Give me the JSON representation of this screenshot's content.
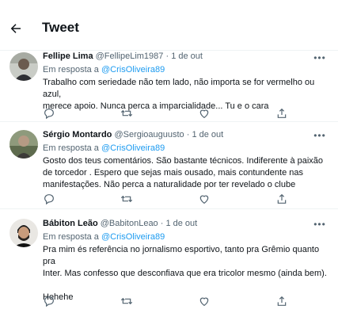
{
  "header": {
    "title": "Tweet"
  },
  "tweets": [
    {
      "name": "Fellipe Lima",
      "handle": "@FellipeLim1987",
      "time": "· 1 de out",
      "reply_prefix": "Em resposta a ",
      "reply_to": "@CrisOliveira89",
      "lines": [
        "Trabalho com seriedade não tem lado, não importa se for vermelho ou azul,",
        "merece apoio. Nunca perca a imparcialidade... Tu e o cara"
      ]
    },
    {
      "name": "Sérgio Montardo",
      "handle": "@Sergioauguusto",
      "time": "· 1 de out",
      "reply_prefix": "Em resposta a ",
      "reply_to": "@CrisOliveira89",
      "lines": [
        "Gosto dos teus comentários. São bastante técnicos. Indiferente à paixão",
        "de torcedor . Espero que sejas mais ousado, mais contundente nas",
        "manifestações. Não perca a naturalidade por ter revelado o clube"
      ]
    },
    {
      "name": "Bábiton Leão",
      "handle": "@BabitonLeao",
      "time": "· 1 de out",
      "reply_prefix": "Em resposta a ",
      "reply_to": "@CrisOliveira89",
      "lines": [
        "Pra mim és referência no jornalismo esportivo, tanto pra Grêmio quanto pra",
        "Inter. Mas confesso que desconfiava que era tricolor mesmo (ainda bem).",
        "",
        "Hehehe"
      ]
    }
  ],
  "colors": {
    "link": "#1d9bf0",
    "secondary": "#536471",
    "border": "#eff3f4"
  },
  "icons": [
    "back-arrow-icon",
    "more-icon",
    "reply-icon",
    "retweet-icon",
    "like-icon",
    "share-icon"
  ]
}
